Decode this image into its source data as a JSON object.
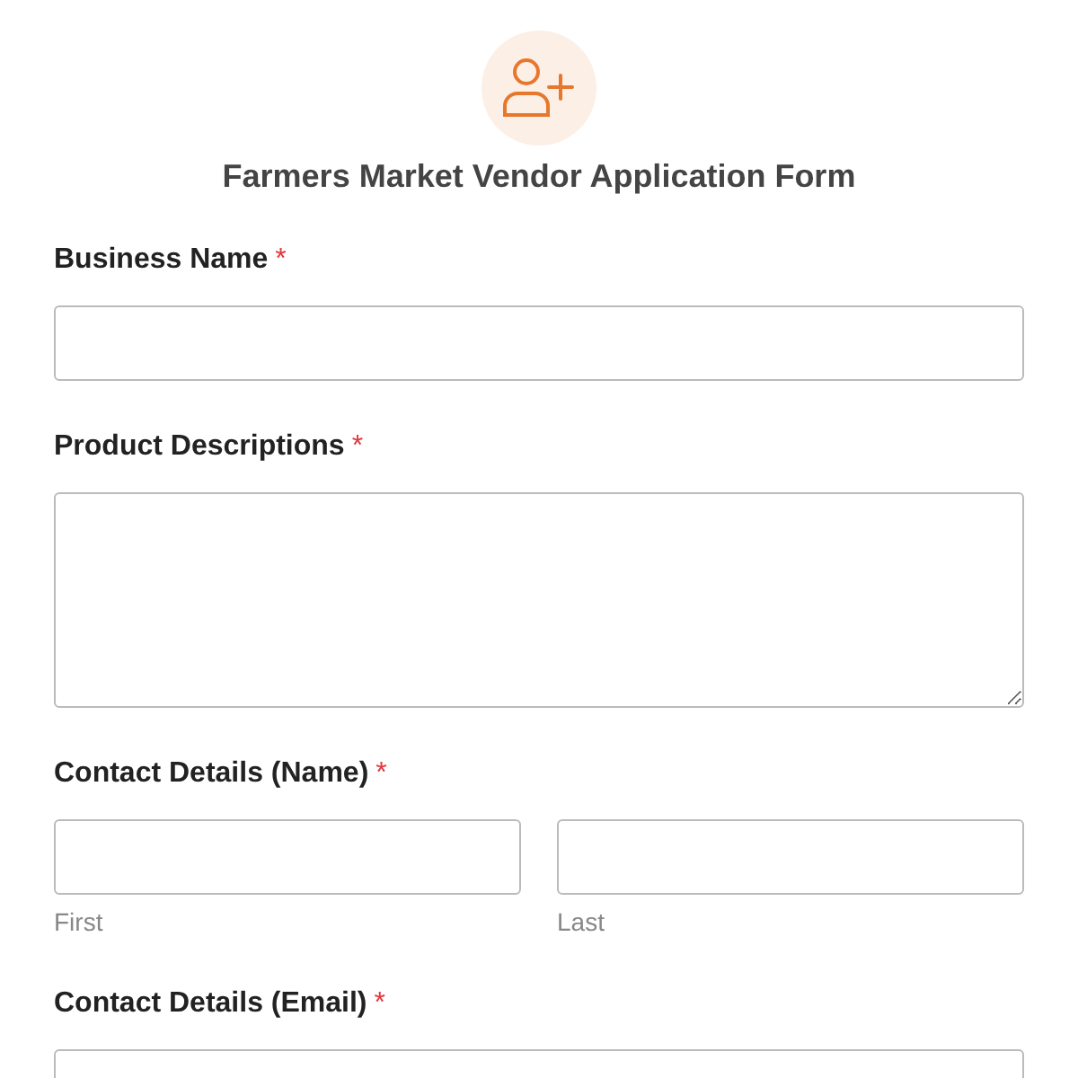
{
  "title": "Farmers Market Vendor Application Form",
  "fields": [
    {
      "kind": "text",
      "label": "Business Name",
      "required_mark": "*"
    },
    {
      "kind": "textarea",
      "label": "Product Descriptions",
      "required_mark": "*"
    },
    {
      "kind": "name",
      "label": "Contact Details (Name)",
      "required_mark": "*",
      "sublabels": [
        "First",
        "Last"
      ]
    },
    {
      "kind": "text",
      "label": "Contact Details (Email)",
      "required_mark": "*"
    }
  ]
}
